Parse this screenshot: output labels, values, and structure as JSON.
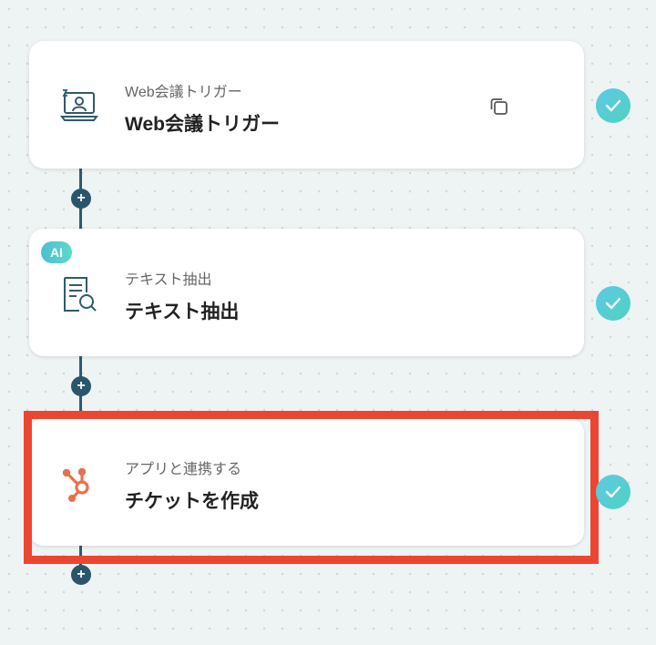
{
  "steps": [
    {
      "subtitle": "Web会議トリガー",
      "title": "Web会議トリガー",
      "icon": "video-meeting-icon",
      "status": "completed"
    },
    {
      "badge": "AI",
      "subtitle": "テキスト抽出",
      "title": "テキスト抽出",
      "icon": "document-search-icon",
      "status": "completed"
    },
    {
      "subtitle": "アプリと連携する",
      "title": "チケットを作成",
      "icon": "hubspot-icon",
      "status": "completed"
    }
  ],
  "add_step_symbol": "+",
  "colors": {
    "connector": "#2f5a6e",
    "highlight": "#ec4632",
    "check_gradient_start": "#5ec9e6",
    "check_gradient_end": "#4fd2c0",
    "hubspot": "#e8704f"
  }
}
